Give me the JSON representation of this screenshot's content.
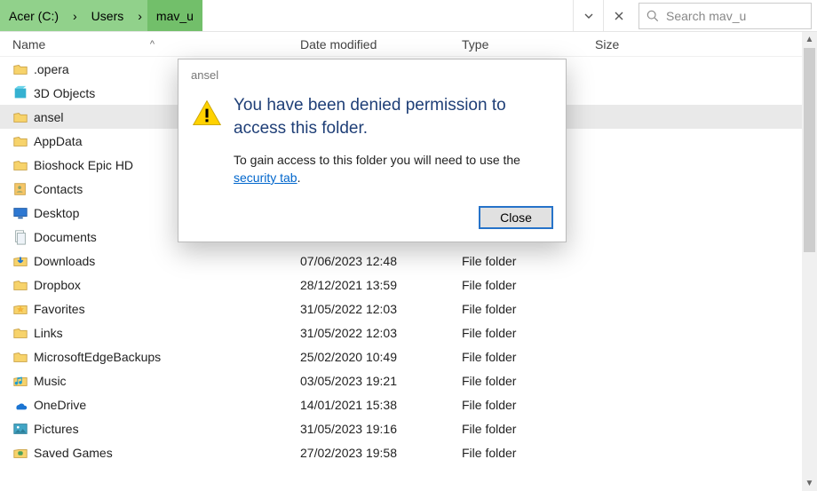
{
  "breadcrumbs": [
    "Acer (C:)",
    "Users",
    "mav_u"
  ],
  "search": {
    "placeholder": "Search mav_u"
  },
  "columns": {
    "name": "Name",
    "date": "Date modified",
    "type": "Type",
    "size": "Size"
  },
  "files": [
    {
      "name": ".opera",
      "date": "",
      "type": "",
      "icon": "folder",
      "selected": false
    },
    {
      "name": "3D Objects",
      "date": "",
      "type": "",
      "icon": "3d",
      "selected": false
    },
    {
      "name": "ansel",
      "date": "",
      "type": "",
      "icon": "folder",
      "selected": true
    },
    {
      "name": "AppData",
      "date": "",
      "type": "",
      "icon": "folder",
      "selected": false
    },
    {
      "name": "Bioshock Epic HD",
      "date": "",
      "type": "",
      "icon": "folder",
      "selected": false
    },
    {
      "name": "Contacts",
      "date": "",
      "type": "",
      "icon": "contacts",
      "selected": false
    },
    {
      "name": "Desktop",
      "date": "",
      "type": "",
      "icon": "desktop",
      "selected": false
    },
    {
      "name": "Documents",
      "date": "",
      "type": "",
      "icon": "documents",
      "selected": false
    },
    {
      "name": "Downloads",
      "date": "07/06/2023 12:48",
      "type": "File folder",
      "icon": "downloads",
      "selected": false
    },
    {
      "name": "Dropbox",
      "date": "28/12/2021 13:59",
      "type": "File folder",
      "icon": "folder",
      "selected": false
    },
    {
      "name": "Favorites",
      "date": "31/05/2022 12:03",
      "type": "File folder",
      "icon": "favorites",
      "selected": false
    },
    {
      "name": "Links",
      "date": "31/05/2022 12:03",
      "type": "File folder",
      "icon": "folder",
      "selected": false
    },
    {
      "name": "MicrosoftEdgeBackups",
      "date": "25/02/2020 10:49",
      "type": "File folder",
      "icon": "folder",
      "selected": false
    },
    {
      "name": "Music",
      "date": "03/05/2023 19:21",
      "type": "File folder",
      "icon": "music",
      "selected": false
    },
    {
      "name": "OneDrive",
      "date": "14/01/2021 15:38",
      "type": "File folder",
      "icon": "onedrive",
      "selected": false
    },
    {
      "name": "Pictures",
      "date": "31/05/2023 19:16",
      "type": "File folder",
      "icon": "pictures",
      "selected": false
    },
    {
      "name": "Saved Games",
      "date": "27/02/2023 19:58",
      "type": "File folder",
      "icon": "games",
      "selected": false
    }
  ],
  "dialog": {
    "title": "ansel",
    "heading": "You have been denied permission to access this folder.",
    "message_pre": "To gain access to this folder you will need to use the ",
    "link_text": "security tab",
    "message_post": ".",
    "close": "Close"
  }
}
